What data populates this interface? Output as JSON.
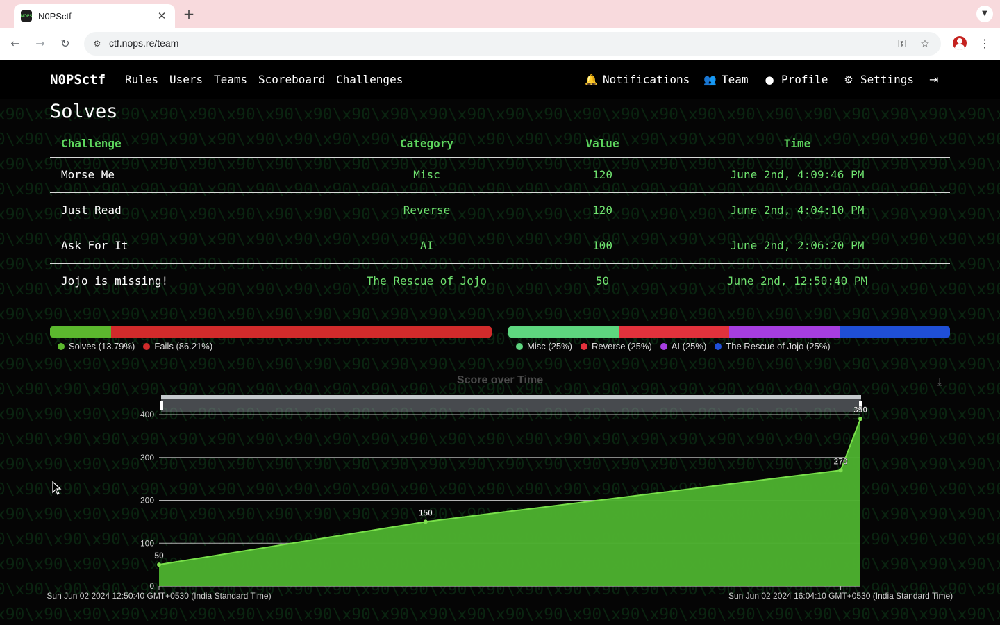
{
  "browser": {
    "tab_title": "N0PSctf",
    "url": "ctf.nops.re/team",
    "favicon_text": "NOPS",
    "icons": [
      "back-icon",
      "forward-icon",
      "reload-icon",
      "site-info-icon",
      "password-key-icon",
      "bookmark-star-icon",
      "profile-avatar-icon",
      "kebab-menu-icon"
    ]
  },
  "navbar": {
    "brand": "N0PSctf",
    "links": [
      "Rules",
      "Users",
      "Teams",
      "Scoreboard",
      "Challenges"
    ],
    "right": {
      "notifications": "Notifications",
      "team": "Team",
      "profile": "Profile",
      "settings": "Settings"
    }
  },
  "solves": {
    "title": "Solves",
    "headers": [
      "Challenge",
      "Category",
      "Value",
      "Time"
    ],
    "rows": [
      {
        "challenge": "Morse Me",
        "category": "Misc",
        "value": "120",
        "time": "June 2nd, 4:09:46 PM"
      },
      {
        "challenge": "Just Read",
        "category": "Reverse",
        "value": "120",
        "time": "June 2nd, 4:04:10 PM"
      },
      {
        "challenge": "Ask For It",
        "category": "AI",
        "value": "100",
        "time": "June 2nd, 2:06:20 PM"
      },
      {
        "challenge": "Jojo is missing!",
        "category": "The Rescue of Jojo",
        "value": "50",
        "time": "June 2nd, 12:50:40 PM"
      }
    ]
  },
  "solve_fail_bar": {
    "segments": [
      {
        "label": "Solves (13.79%)",
        "fraction": 0.1379,
        "color": "#5cb82e"
      },
      {
        "label": "Fails (86.21%)",
        "fraction": 0.8621,
        "color": "#d12b2b"
      }
    ]
  },
  "category_bar": {
    "segments": [
      {
        "label": "Misc (25%)",
        "fraction": 0.25,
        "color": "#5ed67f"
      },
      {
        "label": "Reverse (25%)",
        "fraction": 0.25,
        "color": "#e2323c"
      },
      {
        "label": "AI (25%)",
        "fraction": 0.25,
        "color": "#a63ee0"
      },
      {
        "label": "The Rescue of Jojo (25%)",
        "fraction": 0.25,
        "color": "#1f4fd6"
      }
    ]
  },
  "chart_data": {
    "type": "area",
    "title": "Score over Time",
    "xlabel": "",
    "ylabel": "",
    "ylim": [
      0,
      400
    ],
    "yticks": [
      0,
      100,
      200,
      300,
      400
    ],
    "x_tick_labels": [
      "Sun Jun 02 2024 12:50:40 GMT+0530 (India Standard Time)",
      "Sun Jun 02 2024 16:04:10 GMT+0530 (India Standard Time)"
    ],
    "x": [
      "2024-06-02 12:50:40",
      "2024-06-02 14:06:20",
      "2024-06-02 16:04:10",
      "2024-06-02 16:09:46"
    ],
    "values": [
      50,
      150,
      270,
      390
    ],
    "data_labels": [
      "50",
      "150",
      "270",
      "390"
    ],
    "color": "#4caf2e",
    "grid": true
  }
}
